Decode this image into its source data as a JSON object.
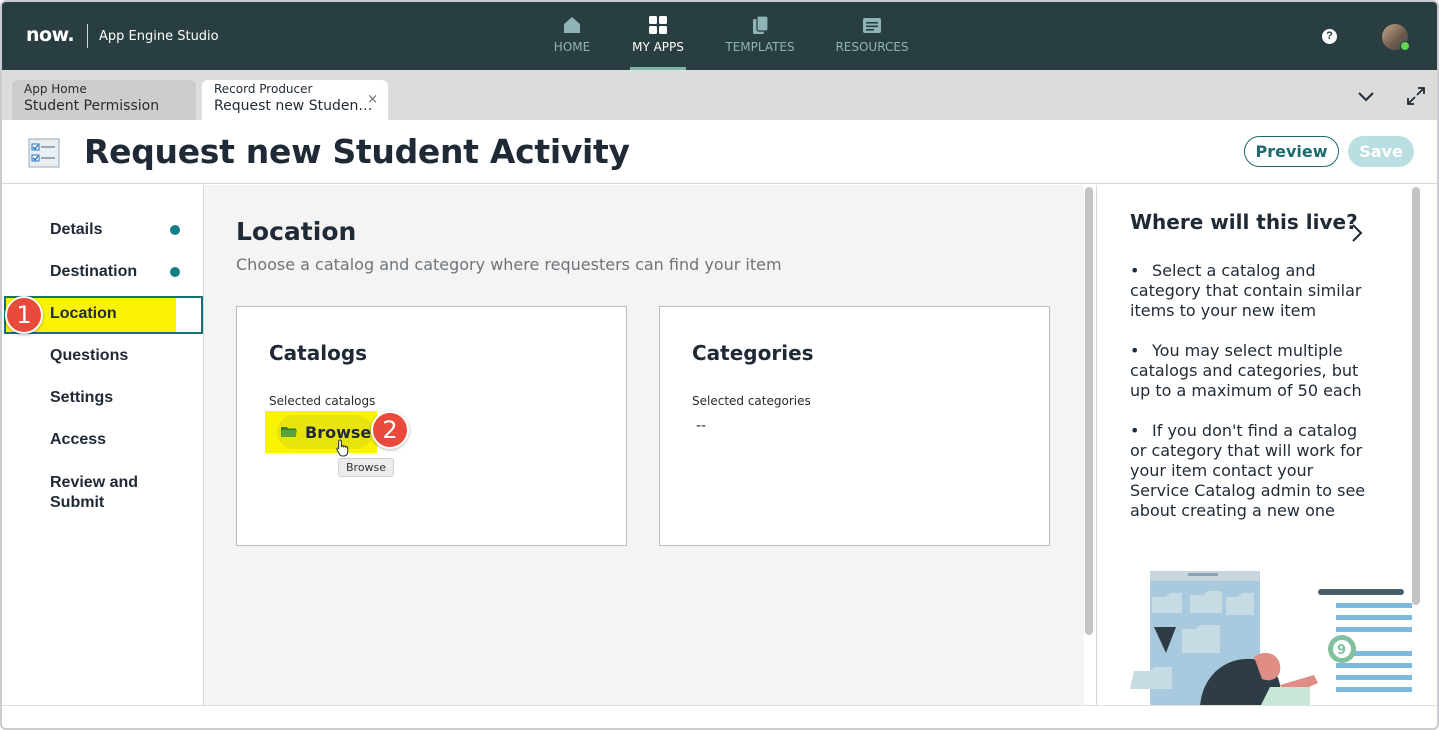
{
  "topnav": {
    "logo": "now.",
    "app_name": "App Engine Studio",
    "items": [
      {
        "label": "HOME",
        "icon": "home-icon"
      },
      {
        "label": "MY APPS",
        "icon": "grid-icon",
        "active": true
      },
      {
        "label": "TEMPLATES",
        "icon": "documents-icon"
      },
      {
        "label": "RESOURCES",
        "icon": "resources-icon"
      }
    ],
    "help": "?"
  },
  "tabs": [
    {
      "type": "App Home",
      "title": "Student Permission"
    },
    {
      "type": "Record Producer",
      "title": "Request new Studen…",
      "close": "×"
    }
  ],
  "header": {
    "title": "Request new Student Activity",
    "preview_label": "Preview",
    "save_label": "Save"
  },
  "steps": [
    {
      "label": "Details",
      "dot": true
    },
    {
      "label": "Destination",
      "dot": true
    },
    {
      "label": "Location",
      "active": true
    },
    {
      "label": "Questions"
    },
    {
      "label": "Settings"
    },
    {
      "label": "Access"
    },
    {
      "label": "Review and Submit"
    }
  ],
  "annotations": {
    "step1": "1",
    "step2": "2"
  },
  "main": {
    "title": "Location",
    "subtitle": "Choose a catalog and category where requesters can find your item",
    "catalogs": {
      "title": "Catalogs",
      "label": "Selected catalogs",
      "browse_label": "Browse",
      "tooltip": "Browse"
    },
    "categories": {
      "title": "Categories",
      "label": "Selected categories",
      "empty": "--"
    }
  },
  "help_panel": {
    "title": "Where will this live?",
    "bullets": [
      "Select a catalog and category that contain similar items to your new item",
      "You may select multiple catalogs and categories, but up to a maximum of 50 each",
      "If you don't find a catalog or category that will work for your item contact your Service Catalog admin to see about creating a new one"
    ]
  },
  "colors": {
    "nav_bg": "#293e40",
    "accent": "#1d6a6f",
    "highlight": "#fbf305",
    "badge": "#ea4a3b",
    "step_dot": "#127e86"
  }
}
